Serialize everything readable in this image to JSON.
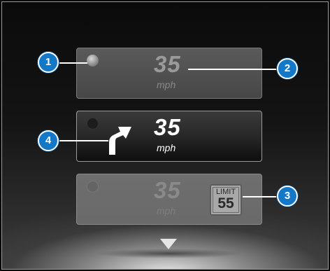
{
  "panels": [
    {
      "speed": "35",
      "unit": "mph"
    },
    {
      "speed": "35",
      "unit": "mph"
    },
    {
      "speed": "35",
      "unit": "mph",
      "limit_label": "LIMIT",
      "limit_value": "55"
    }
  ],
  "icons": {
    "turn": "turn-right-arrow-icon",
    "more": "down-triangle-icon",
    "indicator": "radio-dot-icon"
  },
  "callouts": [
    "1",
    "2",
    "3",
    "4"
  ],
  "colors": {
    "callout": "#1478c8",
    "active_text": "#ffffff"
  }
}
